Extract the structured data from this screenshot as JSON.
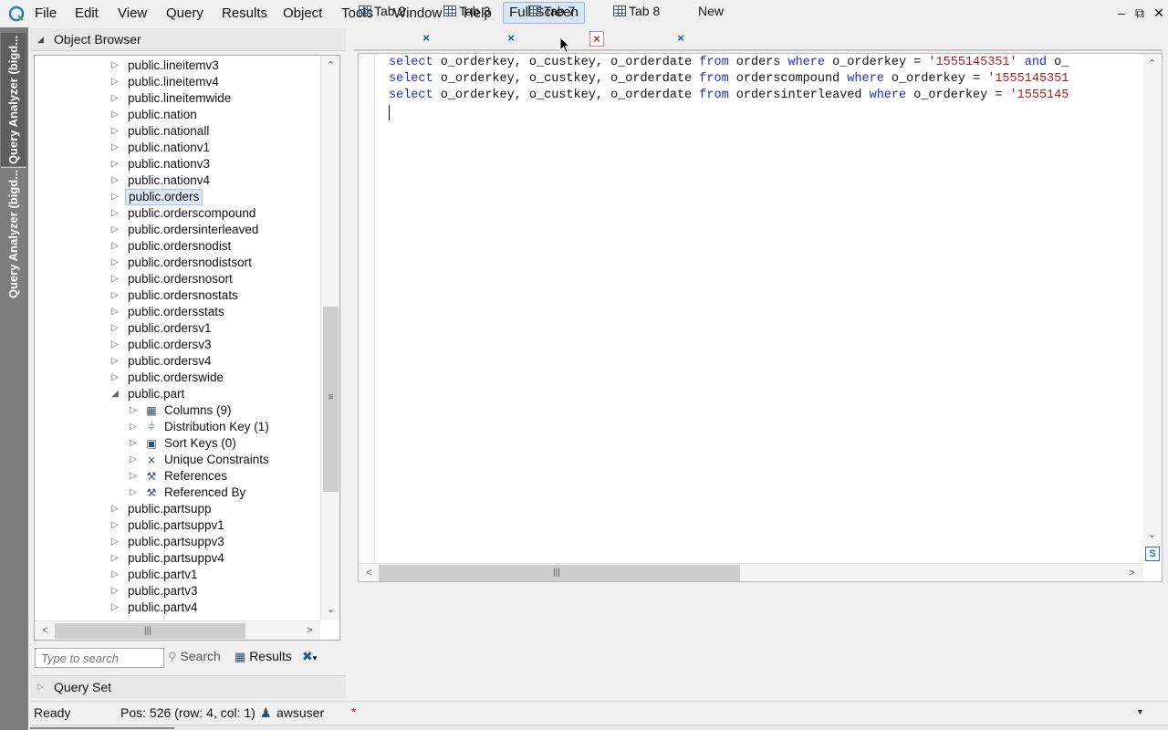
{
  "menu": [
    "File",
    "Edit",
    "View",
    "Query",
    "Results",
    "Object",
    "Tools",
    "Window",
    "Help"
  ],
  "fullscreen_label": "Full Screen",
  "window_controls": {
    "minimize": "–",
    "restore": "⧉",
    "close": "✕"
  },
  "side_tabs": [
    "Query Analyzer (bigd...",
    "Query Analyzer (bigd..."
  ],
  "object_browser": {
    "title": "Object Browser",
    "tree": [
      {
        "label": "public.lineitemv3",
        "level": 0,
        "arrow": "collapsed"
      },
      {
        "label": "public.lineitemv4",
        "level": 0,
        "arrow": "collapsed"
      },
      {
        "label": "public.lineitemwide",
        "level": 0,
        "arrow": "collapsed"
      },
      {
        "label": "public.nation",
        "level": 0,
        "arrow": "collapsed"
      },
      {
        "label": "public.nationall",
        "level": 0,
        "arrow": "collapsed"
      },
      {
        "label": "public.nationv1",
        "level": 0,
        "arrow": "collapsed"
      },
      {
        "label": "public.nationv3",
        "level": 0,
        "arrow": "collapsed"
      },
      {
        "label": "public.nationv4",
        "level": 0,
        "arrow": "collapsed"
      },
      {
        "label": "public.orders",
        "level": 0,
        "arrow": "collapsed",
        "selected": true
      },
      {
        "label": "public.orderscompound",
        "level": 0,
        "arrow": "collapsed"
      },
      {
        "label": "public.ordersinterleaved",
        "level": 0,
        "arrow": "collapsed"
      },
      {
        "label": "public.ordersnodist",
        "level": 0,
        "arrow": "collapsed"
      },
      {
        "label": "public.ordersnodistsort",
        "level": 0,
        "arrow": "collapsed"
      },
      {
        "label": "public.ordersnosort",
        "level": 0,
        "arrow": "collapsed"
      },
      {
        "label": "public.ordersnostats",
        "level": 0,
        "arrow": "collapsed"
      },
      {
        "label": "public.ordersstats",
        "level": 0,
        "arrow": "collapsed"
      },
      {
        "label": "public.ordersv1",
        "level": 0,
        "arrow": "collapsed"
      },
      {
        "label": "public.ordersv3",
        "level": 0,
        "arrow": "collapsed"
      },
      {
        "label": "public.ordersv4",
        "level": 0,
        "arrow": "collapsed"
      },
      {
        "label": "public.orderswide",
        "level": 0,
        "arrow": "collapsed"
      },
      {
        "label": "public.part",
        "level": 0,
        "arrow": "expanded"
      },
      {
        "label": "Columns (9)",
        "level": 1,
        "arrow": "collapsed",
        "icon": "columns-icon"
      },
      {
        "label": "Distribution Key (1)",
        "level": 1,
        "arrow": "collapsed",
        "icon": "distribution-key-icon"
      },
      {
        "label": "Sort Keys (0)",
        "level": 1,
        "arrow": "collapsed",
        "icon": "sort-keys-icon"
      },
      {
        "label": "Unique Constraints",
        "level": 1,
        "arrow": "collapsed",
        "icon": "unique-constraints-icon"
      },
      {
        "label": "References",
        "level": 1,
        "arrow": "collapsed",
        "icon": "wrench-icon"
      },
      {
        "label": "Referenced By",
        "level": 1,
        "arrow": "collapsed",
        "icon": "wrench-icon"
      },
      {
        "label": "public.partsupp",
        "level": 0,
        "arrow": "collapsed"
      },
      {
        "label": "public.partsuppv1",
        "level": 0,
        "arrow": "collapsed"
      },
      {
        "label": "public.partsuppv3",
        "level": 0,
        "arrow": "collapsed"
      },
      {
        "label": "public.partsuppv4",
        "level": 0,
        "arrow": "collapsed"
      },
      {
        "label": "public.partv1",
        "level": 0,
        "arrow": "collapsed"
      },
      {
        "label": "public.partv3",
        "level": 0,
        "arrow": "collapsed"
      },
      {
        "label": "public.partv4",
        "level": 0,
        "arrow": "collapsed"
      }
    ]
  },
  "search": {
    "placeholder": "Type to search",
    "search_label": "Search",
    "results_label": "Results"
  },
  "query_set": {
    "title": "Query Set"
  },
  "tabs": [
    {
      "label": "Tab 2",
      "active": false
    },
    {
      "label": "Tab 3",
      "active": false
    },
    {
      "label": "Tab 7",
      "active": true
    },
    {
      "label": "Tab 8",
      "active": false
    }
  ],
  "new_tab_label": "New",
  "editor": {
    "lines": [
      [
        [
          "kw",
          "select"
        ],
        [
          "plain",
          " o_orderkey, o_custkey, o_orderdate "
        ],
        [
          "kw",
          "from"
        ],
        [
          "plain",
          " orders "
        ],
        [
          "kw",
          "where"
        ],
        [
          "plain",
          " o_orderkey = "
        ],
        [
          "str",
          "'1555145351'"
        ],
        [
          "plain",
          " "
        ],
        [
          "kw",
          "and"
        ],
        [
          "plain",
          " o_"
        ]
      ],
      [
        [
          "kw",
          "select"
        ],
        [
          "plain",
          " o_orderkey, o_custkey, o_orderdate "
        ],
        [
          "kw",
          "from"
        ],
        [
          "plain",
          " orderscompound "
        ],
        [
          "kw",
          "where"
        ],
        [
          "plain",
          " o_orderkey = "
        ],
        [
          "str",
          "'1555145351"
        ]
      ],
      [
        [
          "kw",
          "select"
        ],
        [
          "plain",
          " o_orderkey, o_custkey, o_orderdate "
        ],
        [
          "kw",
          "from"
        ],
        [
          "plain",
          " ordersinterleaved "
        ],
        [
          "kw",
          "where"
        ],
        [
          "plain",
          " o_orderkey = "
        ],
        [
          "str",
          "'1555145"
        ]
      ]
    ]
  },
  "status": {
    "ready": "Ready",
    "position": "Pos: 526 (row: 4, col: 1)",
    "user": "awsuser",
    "modified": "*"
  },
  "colors": {
    "keyword": "#1b2fd0",
    "string": "#b11c1c",
    "selection": "#dce8f8"
  }
}
